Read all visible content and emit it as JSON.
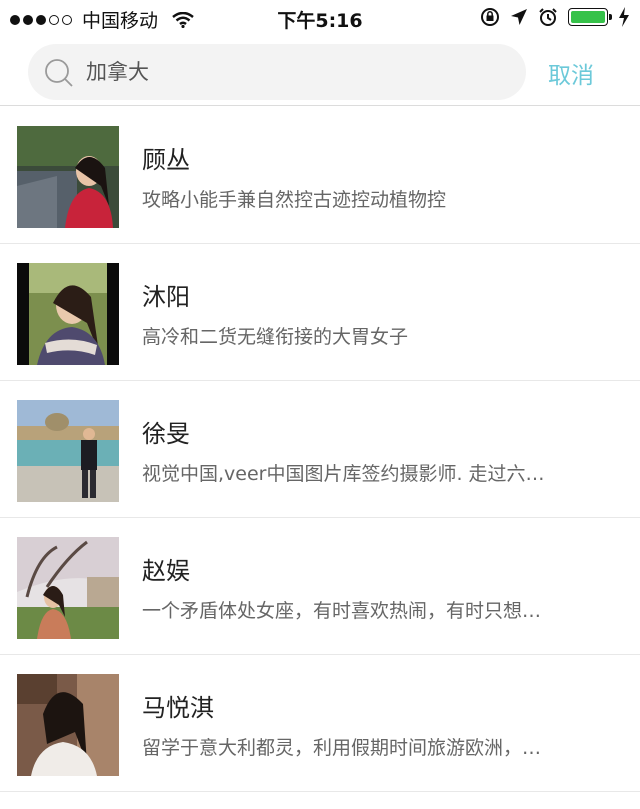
{
  "status_bar": {
    "carrier": "中国移动",
    "time": "下午5:16",
    "signal_icon": "signal-dots-icon",
    "wifi_icon": "wifi-icon",
    "battery_color": "#36c24a"
  },
  "search": {
    "value": "加拿大",
    "icon": "search-icon",
    "cancel_label": "取消",
    "cancel_color": "#6cc9d9"
  },
  "results": [
    {
      "name": "顾丛",
      "desc": "攻略小能手兼自然控古迹控动植物控"
    },
    {
      "name": "沐阳",
      "desc": "高冷和二货无缝衔接的大胃女子"
    },
    {
      "name": "徐旻",
      "desc": "视觉中国,veer中国图片库签约摄影师. 走过六…"
    },
    {
      "name": "赵娱",
      "desc": "一个矛盾体处女座，有时喜欢热闹，有时只想…"
    },
    {
      "name": "马悦淇",
      "desc": "留学于意大利都灵，利用假期时间旅游欧洲，…"
    }
  ]
}
